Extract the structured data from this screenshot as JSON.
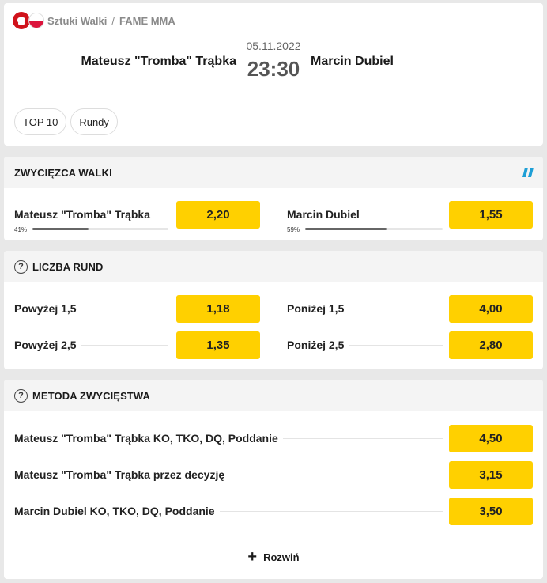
{
  "breadcrumb": {
    "sport": "Sztuki Walki",
    "separator": "/",
    "league": "FAME MMA"
  },
  "match": {
    "home": "Mateusz \"Tromba\" Trąbka",
    "away": "Marcin Dubiel",
    "date": "05.11.2022",
    "time": "23:30"
  },
  "tabs": [
    "TOP 10",
    "Rundy"
  ],
  "markets": {
    "winner": {
      "title": "ZWYCIĘZCA WALKI",
      "selections": [
        {
          "label": "Mateusz \"Tromba\" Trąbka",
          "odd": "2,20",
          "pct_label": "41%",
          "pct": 0.41
        },
        {
          "label": "Marcin Dubiel",
          "odd": "1,55",
          "pct_label": "59%",
          "pct": 0.59
        }
      ]
    },
    "rounds": {
      "title": "LICZBA RUND",
      "selections": [
        {
          "label": "Powyżej 1,5",
          "odd": "1,18"
        },
        {
          "label": "Poniżej 1,5",
          "odd": "4,00"
        },
        {
          "label": "Powyżej 2,5",
          "odd": "1,35"
        },
        {
          "label": "Poniżej 2,5",
          "odd": "2,80"
        }
      ]
    },
    "method": {
      "title": "METODA ZWYCIĘSTWA",
      "selections": [
        {
          "label": "Mateusz \"Tromba\" Trąbka KO, TKO, DQ, Poddanie",
          "odd": "4,50"
        },
        {
          "label": "Mateusz \"Tromba\" Trąbka przez decyzję",
          "odd": "3,15"
        },
        {
          "label": "Marcin Dubiel KO, TKO, DQ, Poddanie",
          "odd": "3,50"
        }
      ],
      "expand_label": "Rozwiń"
    }
  },
  "colors": {
    "odd_bg": "#ffd000",
    "accent_blue": "#1e9fd6",
    "sport_icon": "#d0121b"
  }
}
